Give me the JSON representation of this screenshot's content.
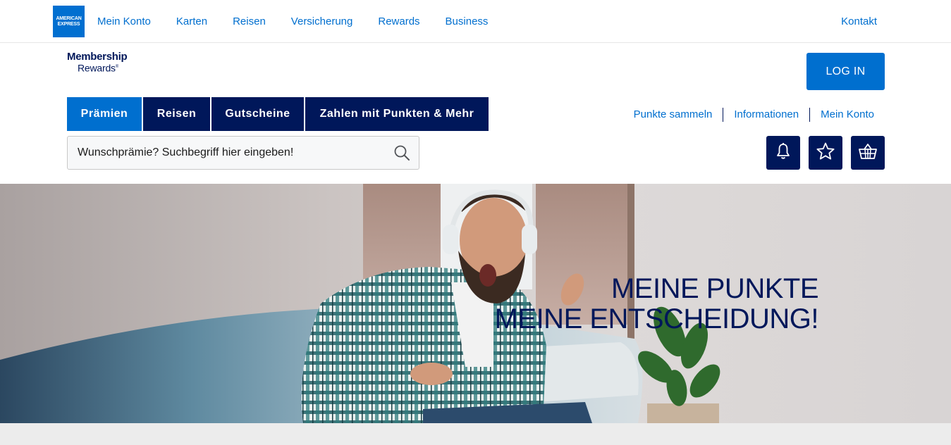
{
  "brand": {
    "amex_logo_line1": "AMERICAN",
    "amex_logo_line2": "EXPRESS",
    "program_line1": "Membership",
    "program_line2": "Rewards",
    "program_mark": "®"
  },
  "global_nav": {
    "items": [
      {
        "label": "Mein Konto"
      },
      {
        "label": "Karten"
      },
      {
        "label": "Reisen"
      },
      {
        "label": "Versicherung"
      },
      {
        "label": "Rewards"
      },
      {
        "label": "Business"
      }
    ],
    "contact_label": "Kontakt"
  },
  "header": {
    "login_label": "LOG IN"
  },
  "category_tabs": [
    {
      "label": "Prämien",
      "active": true
    },
    {
      "label": "Reisen",
      "active": false
    },
    {
      "label": "Gutscheine",
      "active": false
    },
    {
      "label": "Zahlen mit Punkten & Mehr",
      "active": false
    }
  ],
  "utility_links": [
    {
      "label": "Punkte sammeln"
    },
    {
      "label": "Informationen"
    },
    {
      "label": "Mein Konto"
    }
  ],
  "search": {
    "placeholder": "Wunschprämie? Suchbegriff hier eingeben!",
    "value": ""
  },
  "icon_buttons": [
    {
      "icon": "bell-icon"
    },
    {
      "icon": "star-icon"
    },
    {
      "icon": "basket-icon"
    }
  ],
  "hero": {
    "line1": "MEINE PUNKTE",
    "line2": "MEINE ENTSCHEIDUNG!"
  },
  "colors": {
    "brand_blue": "#006fcf",
    "navy": "#00175a",
    "band_gray": "#ececec"
  }
}
